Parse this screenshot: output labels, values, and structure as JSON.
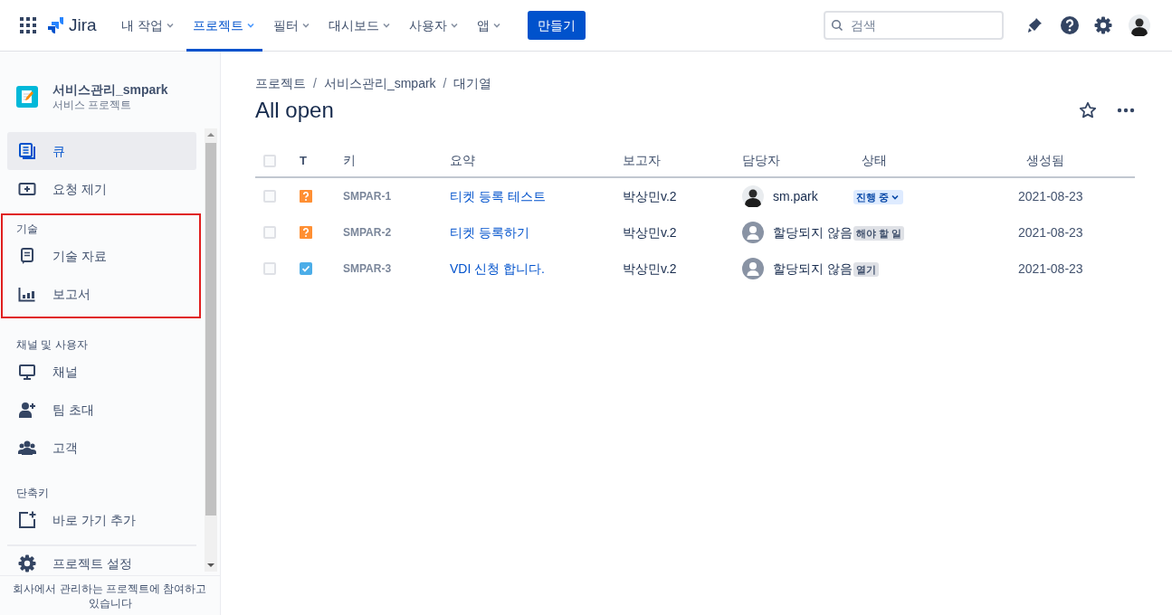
{
  "topbar": {
    "product": "Jira",
    "nav": [
      {
        "label": "내 작업",
        "selected": false
      },
      {
        "label": "프로젝트",
        "selected": true
      },
      {
        "label": "필터",
        "selected": false
      },
      {
        "label": "대시보드",
        "selected": false
      },
      {
        "label": "사용자",
        "selected": false
      },
      {
        "label": "앱",
        "selected": false
      }
    ],
    "create_button": "만들기",
    "search": {
      "placeholder": "검색"
    }
  },
  "sidebar": {
    "project": {
      "name": "서비스관리_smpark",
      "type": "서비스 프로젝트"
    },
    "sections": [
      {
        "items": [
          {
            "label": "큐",
            "selected": true
          },
          {
            "label": "요청 제기",
            "selected": false
          }
        ]
      },
      {
        "title": "기술",
        "highlighted": true,
        "items": [
          {
            "label": "기술 자료",
            "selected": false
          },
          {
            "label": "보고서",
            "selected": false
          }
        ]
      },
      {
        "title": "채널 및 사용자",
        "items": [
          {
            "label": "채널",
            "selected": false
          },
          {
            "label": "팀 초대",
            "selected": false
          },
          {
            "label": "고객",
            "selected": false
          }
        ]
      },
      {
        "title": "단축키",
        "items": [
          {
            "label": "바로 가기 추가",
            "selected": false
          }
        ]
      },
      {
        "divider": true,
        "items": [
          {
            "label": "프로젝트 설정",
            "selected": false
          }
        ]
      }
    ],
    "footer": "회사에서 관리하는 프로젝트에 참여하고 있습니다"
  },
  "breadcrumbs": [
    "프로젝트",
    "/",
    "서비스관리_smpark",
    "/",
    "대기열"
  ],
  "page_title": "All open",
  "table": {
    "select_all_checked": false,
    "columns": [
      "T",
      "키",
      "요약",
      "보고자",
      "담당자",
      "상태",
      "생성됨"
    ],
    "rows": [
      {
        "checked": false,
        "kind": "question",
        "key": "SMPAR-1",
        "summary": "티켓 등록 테스트",
        "reporter": "박상민v.2",
        "assignee": {
          "kind": "photo",
          "name": "sm.park"
        },
        "status": {
          "label": "진행 중",
          "kind": "inprogress",
          "dropdown": true
        },
        "created": "2021-08-23"
      },
      {
        "checked": false,
        "kind": "question",
        "key": "SMPAR-2",
        "summary": "티켓 등록하기",
        "reporter": "박상민v.2",
        "assignee": {
          "kind": "none",
          "name": "할당되지 않음"
        },
        "status": {
          "label": "해야 할 일",
          "kind": "todo",
          "dropdown": false
        },
        "created": "2021-08-23"
      },
      {
        "checked": false,
        "kind": "task",
        "key": "SMPAR-3",
        "summary": "VDI 신청 합니다.",
        "reporter": "박상민v.2",
        "assignee": {
          "kind": "none",
          "name": "할당되지 않음"
        },
        "status": {
          "label": "열기",
          "kind": "todo",
          "dropdown": false
        },
        "created": "2021-08-23"
      }
    ]
  }
}
